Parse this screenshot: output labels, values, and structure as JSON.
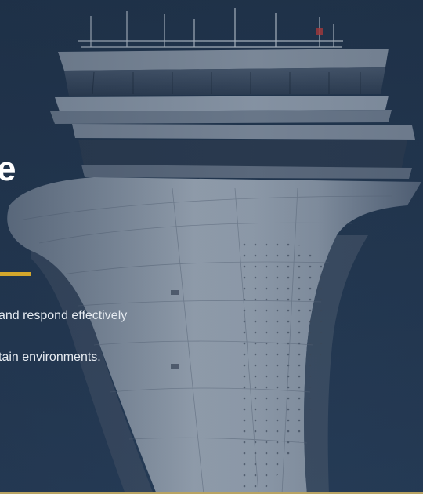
{
  "hero": {
    "headline_fragment": "e",
    "body_line_1": " and respond effectively",
    "body_line_2": "tain environments.",
    "image_subject": "airport-control-tower-photo"
  },
  "colors": {
    "background": "#223650",
    "accent": "#d4a72c",
    "text": "#ffffff",
    "bottom_rule": "#b9a463"
  }
}
